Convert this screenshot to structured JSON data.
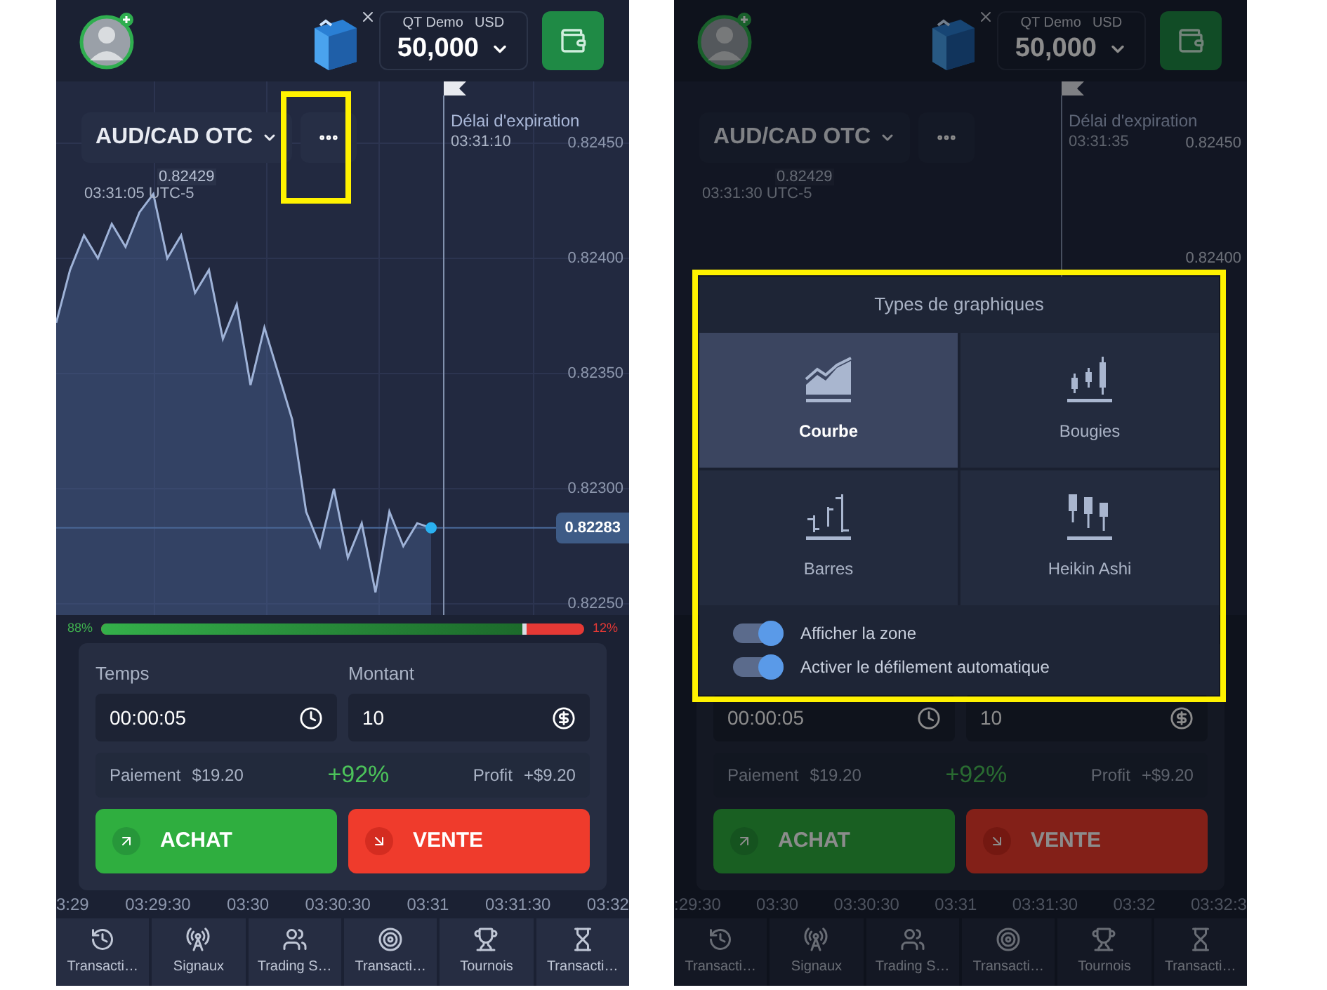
{
  "screens": [
    {
      "header": {
        "account": "QT Demo",
        "currency": "USD",
        "balance": "50,000"
      },
      "asset": {
        "label": "AUD/CAD OTC"
      },
      "more_button": {
        "highlighted": true
      },
      "expiration": {
        "label": "Délai d'expiration",
        "time": "03:31:10"
      },
      "crosshair": {
        "price": "0.82429",
        "time": "03:31:05 UTC-5"
      },
      "chart_data": {
        "type": "area",
        "grid": true,
        "ylim": [
          0.8225,
          0.8245
        ],
        "ref_lines": [
          {
            "axis": "y",
            "value": 0.82283,
            "label": "0.82283"
          }
        ],
        "yticks": [
          {
            "value": 0.8245,
            "label": "0.82450"
          },
          {
            "value": 0.824,
            "label": "0.82400"
          },
          {
            "value": 0.8235,
            "label": "0.82350"
          },
          {
            "value": 0.823,
            "label": "0.82300"
          },
          {
            "value": 0.8225,
            "label": "0.82250"
          }
        ],
        "values": [
          0.82372,
          0.82395,
          0.8241,
          0.824,
          0.82415,
          0.82405,
          0.8242,
          0.82428,
          0.824,
          0.8241,
          0.82385,
          0.82395,
          0.82365,
          0.8238,
          0.82345,
          0.8237,
          0.8235,
          0.8233,
          0.8229,
          0.82275,
          0.823,
          0.8227,
          0.82285,
          0.82255,
          0.8229,
          0.82275,
          0.82285,
          0.82283
        ]
      },
      "sentiment": {
        "up": "88%",
        "down": "12%",
        "level": 0.88
      },
      "trade": {
        "time_label": "Temps",
        "time_value": "00:00:05",
        "amount_label": "Montant",
        "amount_value": "10",
        "payout_label": "Paiement",
        "payout": "$19.20",
        "percent": "+92%",
        "profit_label": "Profit",
        "profit": "+$9.20",
        "buy": "ACHAT",
        "sell": "VENTE"
      },
      "time_axis": [
        "3:29",
        "03:29:30",
        "03:30",
        "03:30:30",
        "03:31",
        "03:31:30",
        "03:32"
      ],
      "nav": [
        {
          "kind": "history",
          "label": "Transacti…"
        },
        {
          "kind": "signals",
          "label": "Signaux"
        },
        {
          "kind": "social",
          "label": "Trading S…"
        },
        {
          "kind": "target",
          "label": "Transacti…"
        },
        {
          "kind": "trophy",
          "label": "Tournois"
        },
        {
          "kind": "hourglass",
          "label": "Transacti…"
        }
      ]
    },
    {
      "dimmed": true,
      "header": {
        "account": "QT Demo",
        "currency": "USD",
        "balance": "50,000"
      },
      "asset": {
        "label": "AUD/CAD OTC"
      },
      "expiration": {
        "label": "Délai d'expiration",
        "time": "03:31:35"
      },
      "crosshair": {
        "price": "0.82429",
        "time": "03:31:30 UTC-5"
      },
      "price_labels": [
        "0.82450",
        "0.82400"
      ],
      "trade": {
        "time_value": "00:00:05",
        "amount_value": "10",
        "payout_label": "Paiement",
        "payout": "$19.20",
        "percent": "+92%",
        "profit_label": "Profit",
        "profit": "+$9.20",
        "buy": "ACHAT",
        "sell": "VENTE"
      },
      "time_axis": [
        ":29:30",
        "03:30",
        "03:30:30",
        "03:31",
        "03:31:30",
        "03:32",
        "03:32:3"
      ],
      "nav": [
        {
          "kind": "history",
          "label": "Transacti…"
        },
        {
          "kind": "signals",
          "label": "Signaux"
        },
        {
          "kind": "social",
          "label": "Trading S…"
        },
        {
          "kind": "target",
          "label": "Transacti…"
        },
        {
          "kind": "trophy",
          "label": "Tournois"
        },
        {
          "kind": "hourglass",
          "label": "Transacti…"
        }
      ],
      "chart_types": {
        "highlighted": true,
        "title": "Types de graphiques",
        "options": [
          {
            "kind": "line",
            "label": "Courbe",
            "selected": true
          },
          {
            "kind": "candles",
            "label": "Bougies",
            "selected": false
          },
          {
            "kind": "bars",
            "label": "Barres",
            "selected": false
          },
          {
            "kind": "heikin_ashi",
            "label": "Heikin Ashi",
            "selected": false
          }
        ],
        "toggles": [
          {
            "label": "Afficher la zone",
            "on": true
          },
          {
            "label": "Activer le défilement automatique",
            "on": true
          }
        ]
      }
    }
  ]
}
